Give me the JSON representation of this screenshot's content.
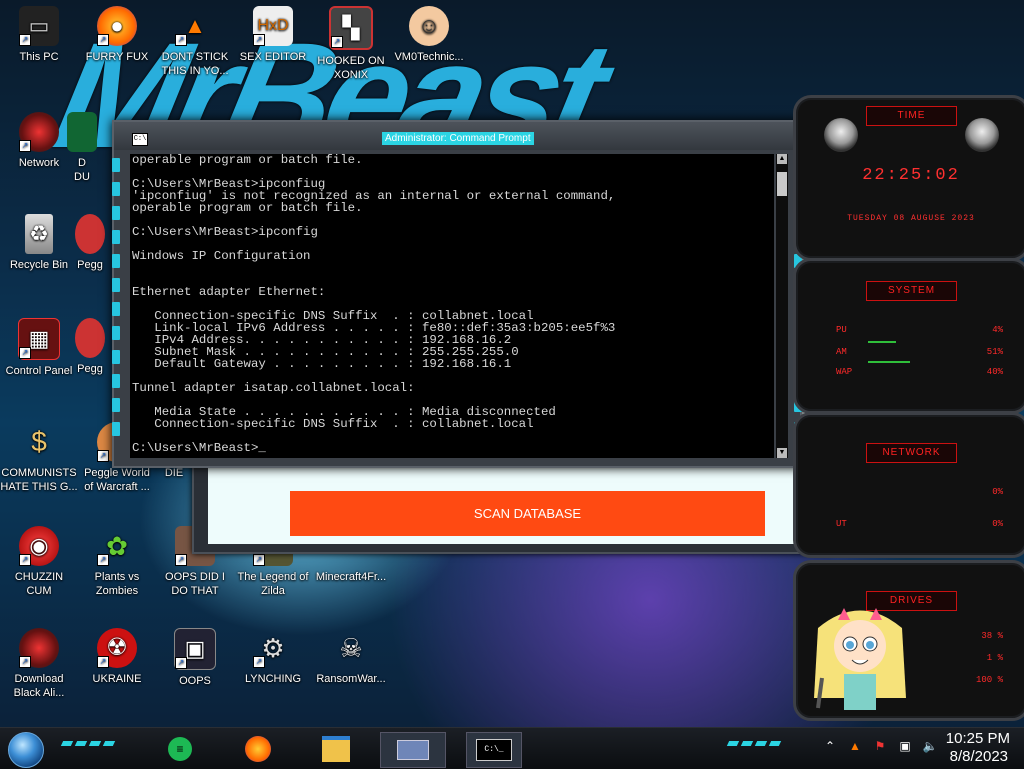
{
  "wallpaper": {
    "logo_text": "MrBeast"
  },
  "desktop_icons": [
    {
      "label": "This PC",
      "icon": "computer-icon"
    },
    {
      "label": "FURRY FUX",
      "icon": "firefox-icon"
    },
    {
      "label": "DONT STICK\nTHIS IN YO...",
      "icon": "vlc-cone-icon"
    },
    {
      "label": "SEX EDITOR",
      "icon": "hxd-icon"
    },
    {
      "label": "HOOKED ON\nXONIX",
      "icon": "xonix-icon"
    },
    {
      "label": "VM0Technic...",
      "icon": "technician-icon"
    },
    {
      "label": "Network",
      "icon": "alien-network-icon"
    },
    {
      "label": "D\nDU",
      "icon": "partial-icon"
    },
    {
      "label": "Recycle Bin",
      "icon": "recycle-bin-icon"
    },
    {
      "label": "Pegg",
      "icon": "peggle-icon"
    },
    {
      "label": "Control Panel",
      "icon": "control-panel-icon"
    },
    {
      "label": "Pegg",
      "icon": "peggle-icon"
    },
    {
      "label": "COMMUNISTS\nHATE THIS G...",
      "icon": "money-bag-icon"
    },
    {
      "label": "Peggle World\nof Warcraft ...",
      "icon": "peggle-warcraft-icon"
    },
    {
      "label": "DIE",
      "icon": "die-icon"
    },
    {
      "label": "CHUZZIN\nCUM",
      "icon": "chuzzle-icon"
    },
    {
      "label": "Plants vs\nZombies",
      "icon": "plants-vs-zombies-icon"
    },
    {
      "label": "OOPS DID I\nDO THAT",
      "icon": "oops-photo-icon"
    },
    {
      "label": "The Legend of\nZilda",
      "icon": "zelda-icon"
    },
    {
      "label": "Minecraft4Fr...",
      "icon": "minecraft-icon"
    },
    {
      "label": "Download\nBlack Ali...",
      "icon": "alien-download-icon"
    },
    {
      "label": "UKRAINE",
      "icon": "radiation-icon"
    },
    {
      "label": "OOPS",
      "icon": "oops-icon"
    },
    {
      "label": "LYNCHING",
      "icon": "lynching-icon"
    },
    {
      "label": "RansomWar...",
      "icon": "skull-icon"
    }
  ],
  "cmd": {
    "title": "Administrator: Command Prompt",
    "app_icon_text": "C:\\",
    "lines": [
      "operable program or batch file.",
      "",
      "C:\\Users\\MrBeast>ipconfiug",
      "'ipconfiug' is not recognized as an internal or external command,",
      "operable program or batch file.",
      "",
      "C:\\Users\\MrBeast>ipconfig",
      "",
      "Windows IP Configuration",
      "",
      "",
      "Ethernet adapter Ethernet:",
      "",
      "   Connection-specific DNS Suffix  . : collabnet.local",
      "   Link-local IPv6 Address . . . . . : fe80::def:35a3:b205:ee5f%3",
      "   IPv4 Address. . . . . . . . . . . : 192.168.16.2",
      "   Subnet Mask . . . . . . . . . . . : 255.255.255.0",
      "   Default Gateway . . . . . . . . . : 192.168.16.1",
      "",
      "Tunnel adapter isatap.collabnet.local:",
      "",
      "   Media State . . . . . . . . . . . : Media disconnected",
      "   Connection-specific DNS Suffix  . : collabnet.local",
      "",
      "C:\\Users\\MrBeast>_"
    ]
  },
  "scan_window": {
    "button_label": "SCAN DATABASE"
  },
  "gadget": {
    "time_title": "TIME",
    "time": "22:25:02",
    "date": "TUESDAY 08 AUGUSE 2023",
    "system_title": "SYSTEM",
    "cpu_label": "PU",
    "cpu_value": "4%",
    "ram_label": "AM",
    "ram_value": "51%",
    "swap_label": "WAP",
    "swap_value": "40%",
    "network_title": "NETWORK",
    "net_in": "0%",
    "net_out_label": "UT",
    "net_out": "0%",
    "drives_title": "DRIVES",
    "drive_values": [
      "38 %",
      "1 %",
      "100 %"
    ]
  },
  "taskbar": {
    "apps": [
      "start-orb-icon",
      "spotify-icon",
      "firefox-icon",
      "file-explorer-icon",
      "app-window-icon",
      "command-prompt-icon"
    ],
    "clock_time": "10:25 PM",
    "clock_date": "8/8/2023",
    "accent": "#2bd4e3"
  }
}
